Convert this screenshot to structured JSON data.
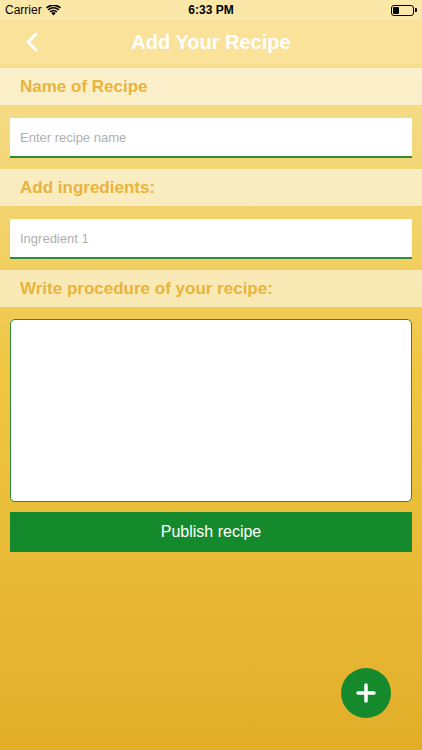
{
  "status_bar": {
    "carrier": "Carrier",
    "time": "6:33 PM",
    "battery": {
      "level": 0.3
    }
  },
  "nav": {
    "title": "Add Your Recipe"
  },
  "sections": [
    {
      "label": "Name of Recipe",
      "kind": "input",
      "placeholder": "Enter recipe name"
    },
    {
      "label": "Add ingredients:",
      "kind": "input",
      "placeholder": "Ingredient 1"
    },
    {
      "label": "Write procedure of your recipe:",
      "kind": "textarea",
      "placeholder": ""
    }
  ],
  "publish_button": {
    "label": "Publish recipe"
  }
}
